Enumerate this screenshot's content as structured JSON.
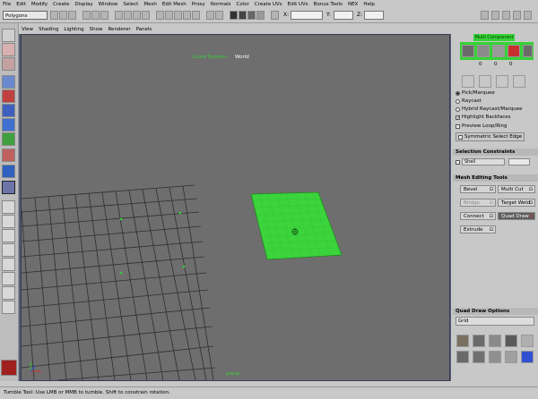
{
  "menubar": [
    "File",
    "Edit",
    "Modify",
    "Create",
    "Display",
    "Window",
    "Select",
    "Mesh",
    "Edit Mesh",
    "Proxy",
    "Normals",
    "Color",
    "Create UVs",
    "Edit UVs",
    "Bonus Tools",
    "NEX",
    "Help"
  ],
  "status": {
    "mode": "Polygons",
    "x_label": "X:",
    "y_label": "Y:",
    "z_label": "Z:"
  },
  "viewport": {
    "menu": [
      "View",
      "Shading",
      "Lighting",
      "Show",
      "Renderer",
      "Panels"
    ],
    "hud_coord_label": "Coord System:",
    "hud_coord_value": "World",
    "camera_label": "persp"
  },
  "nex": {
    "title": "Multi Component",
    "counts": [
      "0",
      "0",
      "0"
    ],
    "options": [
      {
        "label": "Pick/Marquee",
        "type": "radio",
        "on": true
      },
      {
        "label": "Raycast",
        "type": "radio",
        "on": false
      },
      {
        "label": "Hybrid Raycast/Marquee",
        "type": "radio",
        "on": false
      },
      {
        "label": "Highlight Backfaces",
        "type": "check",
        "on": true
      },
      {
        "label": "Preview Loop/Ring",
        "type": "check",
        "on": false
      }
    ],
    "symmetric": "Symmetric Select Edge",
    "constraints_header": "Selection Constraints",
    "constraint_value": "Shell",
    "tools_header": "Mesh Editing Tools",
    "tools": [
      {
        "label": "Bevel",
        "opt": "⊡",
        "dim": false
      },
      {
        "label": "Multi Cut",
        "opt": "⊡",
        "dim": false
      },
      {
        "label": "Bridge",
        "opt": "⊡",
        "dim": true
      },
      {
        "label": "Target Weld",
        "opt": "⊡",
        "dim": false
      },
      {
        "label": "Connect",
        "opt": "⊡",
        "dim": false
      },
      {
        "label": "Quad Draw",
        "opt": "⊡",
        "dim": false,
        "active": true
      },
      {
        "label": "Extrude",
        "opt": "⊡",
        "dim": false
      }
    ],
    "options_header": "Quad Draw Options",
    "grid_label": "Grid"
  },
  "helpline": "Tumble Tool: Use LMB or MMB to tumble. Shift to constrain rotation.",
  "colors": {
    "accent_green": "#36d136",
    "panel": "#c8c8c8",
    "viewport": "#6e6e6e"
  }
}
